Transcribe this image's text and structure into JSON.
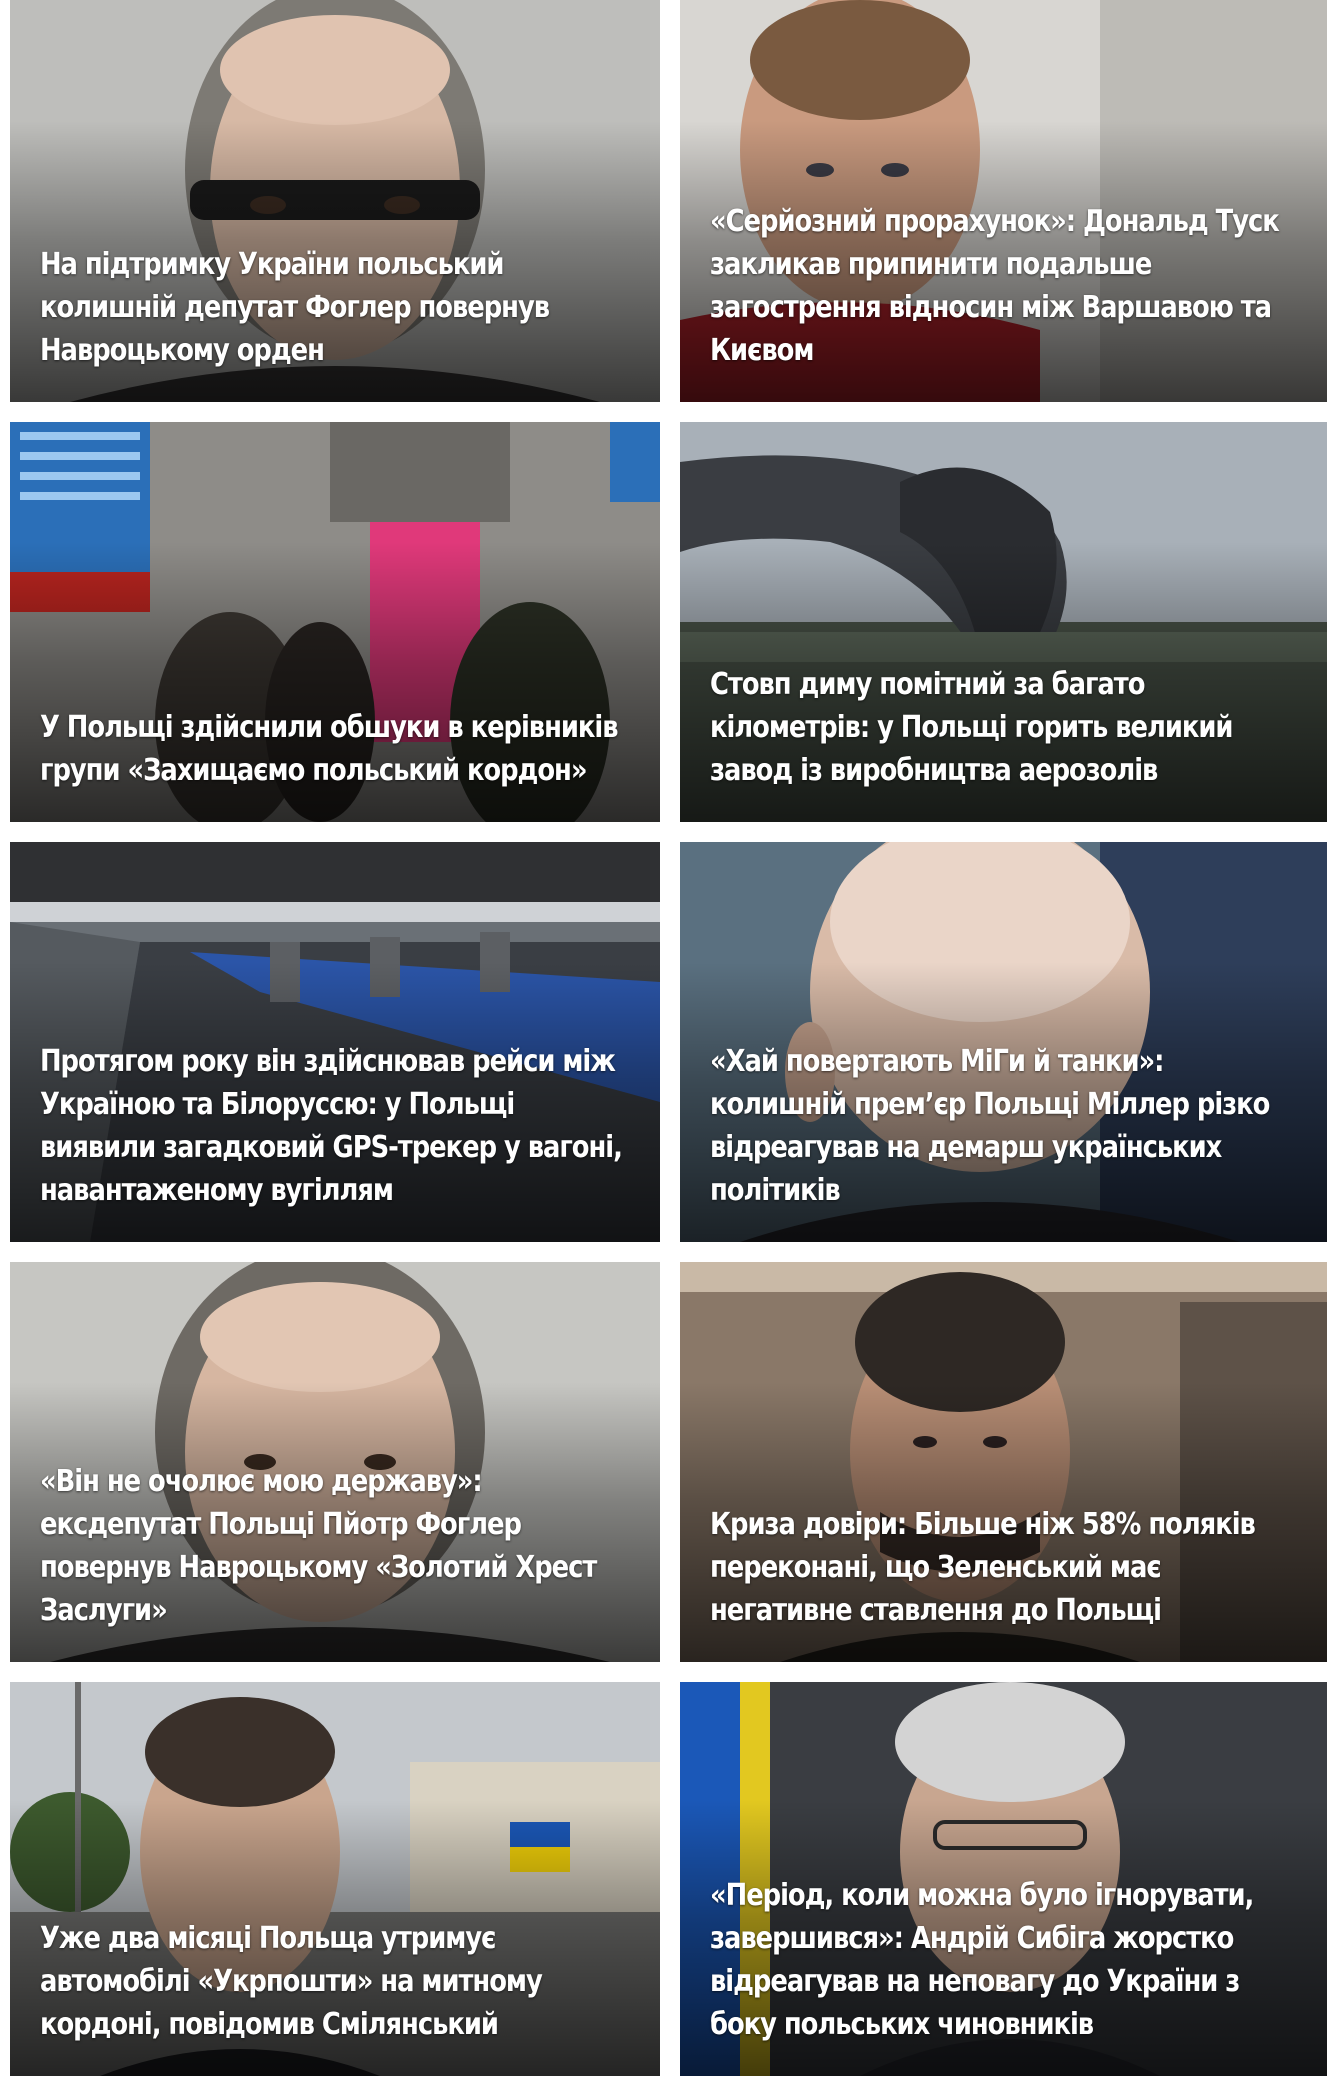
{
  "articles": [
    {
      "title": "На підтримку України польський колишній депутат Фоглер повернув Навроцькому орден",
      "image": "photo-older-man-glasses-grey-bg"
    },
    {
      "title": "«Серйозний прорахунок»: Дональд Туск закликав припинити подальше загострення відносин між Варшавою та Києвом",
      "image": "photo-man-red-jacket"
    },
    {
      "title": "У Польщі здійснили обшуки в керівників групи «Захищаємо польський кордон»",
      "image": "photo-train-station-people"
    },
    {
      "title": "Стовп диму помітний за багато кілометрів: у Польщі горить великий завод із виробництва аерозолів",
      "image": "photo-smoke-plume"
    },
    {
      "title": "Протягом року він здійснював рейси між Україною та Білоруссю: у Польщі виявили загадковий GPS-трекер у вагоні, навантаженому вугіллям",
      "image": "photo-freight-wagons"
    },
    {
      "title": "«Хай повертають МіГи й танки»: колишній прем’єр Польщі Міллер різко відреагував на демарш українських політиків",
      "image": "photo-bald-older-man"
    },
    {
      "title": "«Він не очолює мою державу»: ексдепутат Польщі Пйотр Фоглер повернув Навроцькому «Золотий Хрест Заслуги»",
      "image": "photo-older-man-grey-bg"
    },
    {
      "title": "Криза довіри: Більше ніж 58% поляків переконані, що Зеленський має негативне ставлення до Польщі",
      "image": "photo-zelensky"
    },
    {
      "title": "Уже два місяці Польща утримує автомобілі «Укрпошти» на митному кордоні, повідомив Смілянський",
      "image": "photo-man-building-flag"
    },
    {
      "title": "«Період, коли можна було ігнорувати, завершився»: Андрій Сибіга жорстко відреагував на неповагу до України з боку польських чиновників",
      "image": "photo-grey-hair-man-glasses"
    }
  ]
}
